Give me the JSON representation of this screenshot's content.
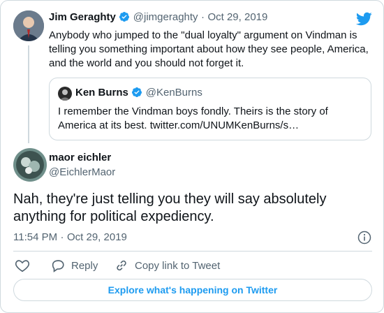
{
  "parent_tweet": {
    "author_name": "Jim Geraghty",
    "author_handle": "@jimgeraghty",
    "separator": "·",
    "date": "Oct 29, 2019",
    "text": "Anybody who jumped to the \"dual loyalty\" argument on Vindman is telling you something important about how they see people, America, and the world and you should not forget it."
  },
  "quoted_tweet": {
    "author_name": "Ken Burns",
    "author_handle": "@KenBurns",
    "text": "I remember the Vindman boys fondly. Theirs is the story of America at its best. twitter.com/UNUMKenBurns/s…"
  },
  "reply_tweet": {
    "author_name": "maor eichler",
    "author_handle": "@EichlerMaor",
    "text": "Nah, they're just telling you they will say absolutely anything for political expediency.",
    "time": "11:54 PM",
    "separator": "·",
    "date": "Oct 29, 2019"
  },
  "actions": {
    "reply_label": "Reply",
    "copy_link_label": "Copy link to Tweet"
  },
  "explore_label": "Explore what's happening on Twitter",
  "colors": {
    "accent": "#1d9bf0",
    "text": "#0f1419",
    "muted": "#536471",
    "border": "#cfd9de"
  },
  "icons": {
    "brand": "twitter-bird-icon",
    "verified": "verified-badge-icon",
    "info": "info-icon",
    "like": "heart-icon",
    "reply": "speech-bubble-icon",
    "copy_link": "link-icon"
  }
}
